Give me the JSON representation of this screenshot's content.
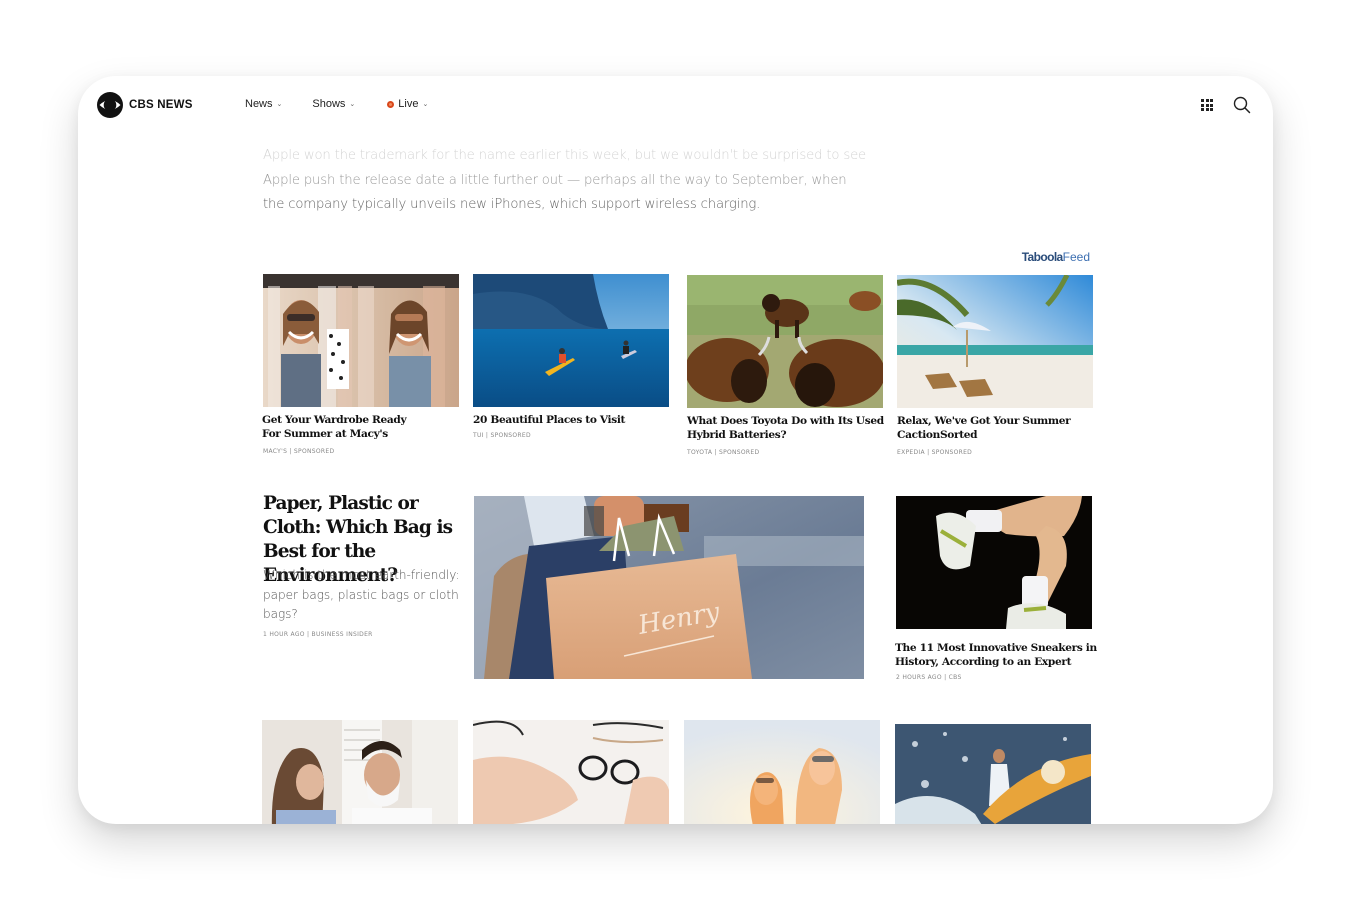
{
  "header": {
    "brand": "CBS NEWS",
    "nav": [
      {
        "label": "News",
        "chevron": "⌄"
      },
      {
        "label": "Shows",
        "chevron": "⌄"
      },
      {
        "label": "Live",
        "chevron": "⌄",
        "live": true
      }
    ],
    "icons": [
      "apps-grid-icon",
      "search-icon"
    ]
  },
  "article": {
    "lines": [
      "Apple won the trademark for the name earlier this week, but we wouldn't be surprised to see",
      "Apple push the release date a little further out — perhaps all the way to September, when",
      "the company typically unveils new iPhones, which support wireless charging."
    ]
  },
  "taboola": {
    "brand": "Taboola",
    "feed": "Feed"
  },
  "sponsored_row": [
    {
      "headline_1": "Get Your Wardrobe Ready",
      "headline_2": "For Summer at Macy's",
      "meta": "MACY'S  |  SPONSORED",
      "image": "two women among clothing racks"
    },
    {
      "headline_1": "20 Beautiful Places to Visit",
      "headline_2": "",
      "meta": "TUI  |  SPONSORED",
      "image": "kayakers on blue sea near cliffs"
    },
    {
      "headline_1": "What Does Toyota Do with Its Used",
      "headline_2": "Hybrid Batteries?",
      "meta": "TOYOTA  |  SPONSORED",
      "image": "bison grazing in grassland"
    },
    {
      "headline_1": "Relax, We've Got Your Summer",
      "headline_2": "CactionSorted",
      "meta": "EXPEDIA  |  SPONSORED",
      "image": "beach loungers under palm tree"
    }
  ],
  "feature": {
    "title": "Paper, Plastic or Cloth: Which Bag is Best for the Environment?",
    "description": "Which is the most earth-friendly: paper bags, plastic bags or cloth bags?",
    "meta": "1 HOUR AGO | BUSINESS INSIDER",
    "image": "hand holding paper shopping bag",
    "bag_text": "Henry"
  },
  "side_story": {
    "headline_1": "The 11 Most Innovative Sneakers in",
    "headline_2": "History, According to an Expert",
    "meta": "2 HOURS AGO | CBS",
    "image": "running legs in white sneakers"
  },
  "bottom_row": [
    {
      "image": "couple shaving in bathroom"
    },
    {
      "image": "hand picking eyeglasses"
    },
    {
      "image": "two women laughing in sunlight"
    },
    {
      "image": "surfer with orange surfboard in spray"
    }
  ],
  "colors": {
    "live_dot": "#d9481b",
    "taboola_blue": "#2a4c7a"
  }
}
